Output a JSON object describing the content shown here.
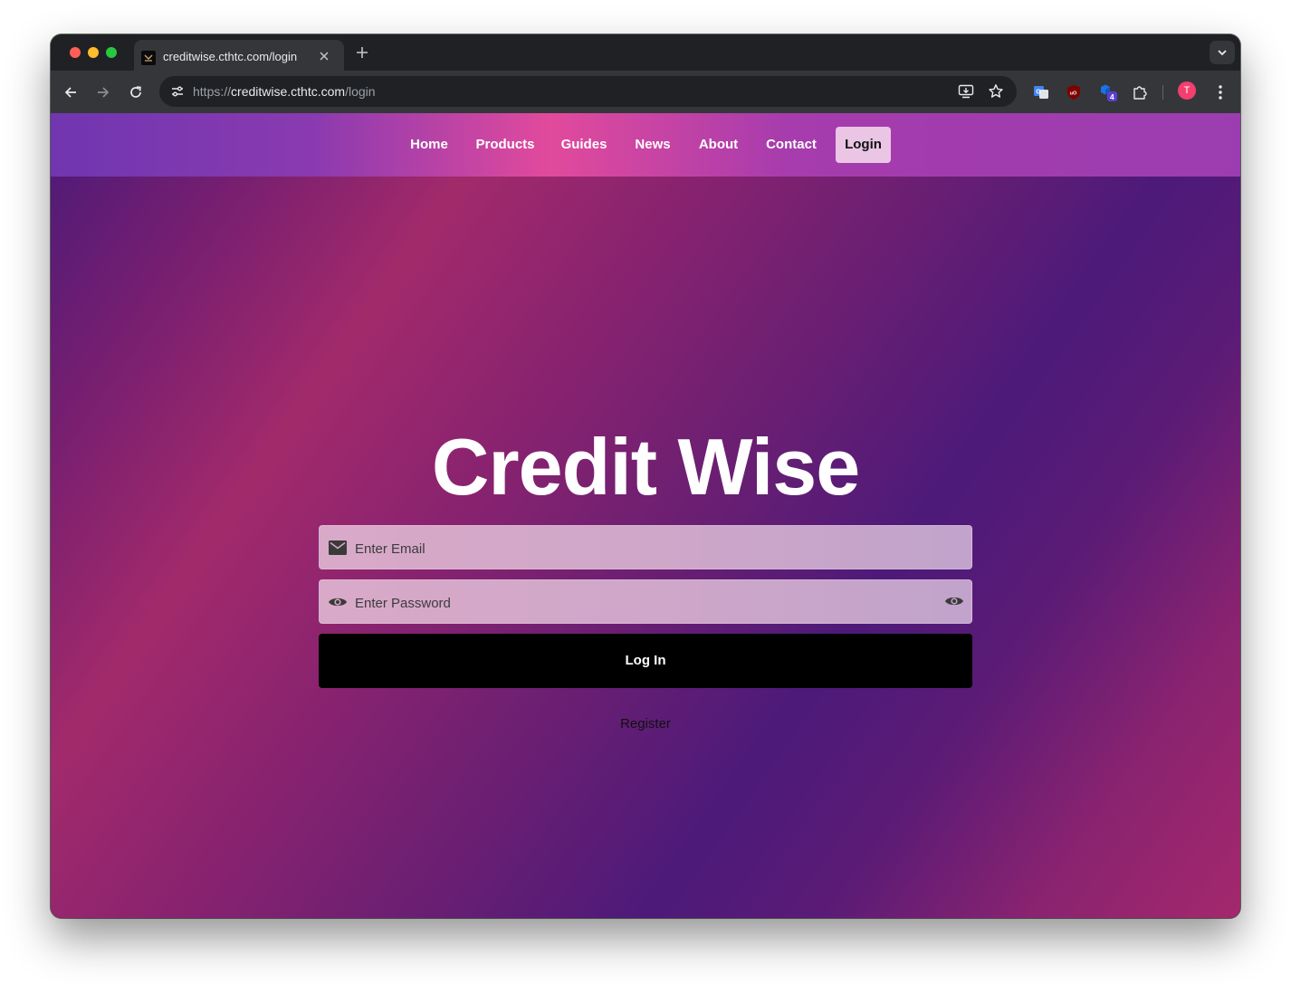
{
  "browser": {
    "tab_title": "creditwise.cthtc.com/login",
    "url_scheme": "https://",
    "url_host": "creditwise.cthtc.com",
    "url_path": "/login",
    "profile_initial": "T",
    "extension_badge": "4"
  },
  "icons": {
    "back": "back-arrow-icon",
    "forward": "forward-arrow-icon",
    "reload": "reload-icon",
    "site_info": "tune-icon",
    "install": "install-app-icon",
    "bookmark": "star-icon",
    "translate": "google-translate-icon",
    "ublock": "ublock-origin-icon",
    "extension_blue": "cube-extension-icon",
    "extensions": "puzzle-icon",
    "menu": "kebab-menu-icon",
    "email": "envelope-icon",
    "password": "eye-icon",
    "toggle": "eye-icon"
  },
  "nav": {
    "items": [
      {
        "label": "Home"
      },
      {
        "label": "Products"
      },
      {
        "label": "Guides"
      },
      {
        "label": "News"
      },
      {
        "label": "About"
      },
      {
        "label": "Contact"
      },
      {
        "label": "Login"
      }
    ],
    "active": "Login"
  },
  "hero": {
    "title": "Credit Wise"
  },
  "form": {
    "email_placeholder": "Enter Email",
    "email_value": "",
    "password_placeholder": "Enter Password",
    "password_value": "",
    "submit_label": "Log In",
    "register_label": "Register"
  },
  "colors": {
    "nav_active_bg": "#eac6e4",
    "button_bg": "#000000",
    "field_bg": "#d0a7c9",
    "accent_pink": "#e24a9c",
    "accent_purple": "#4a1a78"
  }
}
